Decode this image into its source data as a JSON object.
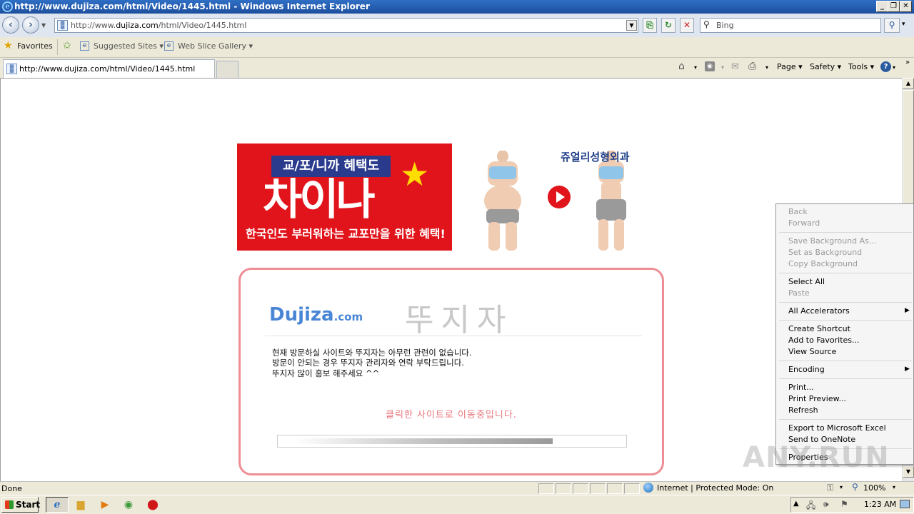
{
  "window": {
    "title": "http://www.dujiza.com/html/Video/1445.html - Windows Internet Explorer",
    "min_glyph": "_",
    "restore_glyph": "❐",
    "close_glyph": "✕"
  },
  "toolbar": {
    "address_prefix": "http://www.",
    "address_domain": "dujiza.com",
    "address_suffix": "/html/Video/1445.html",
    "search_placeholder": "Bing"
  },
  "favorites_bar": {
    "favorites_label": "Favorites",
    "suggested_sites_label": "Suggested Sites",
    "web_slice_gallery_label": "Web Slice Gallery"
  },
  "tabs": {
    "active_tab_label": "http://www.dujiza.com/html/Video/1445.html"
  },
  "command_bar": {
    "page_label": "Page",
    "safety_label": "Safety",
    "tools_label": "Tools"
  },
  "banner": {
    "top_label": "교/포/니까 혜택도",
    "big_label": "차이나",
    "bottom_label": "한국인도 부러워하는 교포만을 위한 혜택!",
    "clinic_name": "쥬얼리성형외과"
  },
  "notice": {
    "brand": "Dujiza",
    "brand_suffix": ".com",
    "brand_korean": "뚜지자",
    "line1": "현재 방문하실 사이트와 뚜지자는 아무런 관련이 없습니다.",
    "line2": "방문이 안되는 경우 뚜지자 관리자와 연락 부탁드립니다.",
    "line3": "뚜지자 많이 홍보 해주세요 ^^",
    "redirect_message": "클릭한 사이트로 이동중입니다.",
    "progress_fraction": 0.78
  },
  "context_menu": {
    "back": "Back",
    "forward": "Forward",
    "save_background": "Save Background As...",
    "set_as_background": "Set as Background",
    "copy_background": "Copy Background",
    "select_all": "Select All",
    "paste": "Paste",
    "all_accelerators": "All Accelerators",
    "create_shortcut": "Create Shortcut",
    "add_to_favorites": "Add to Favorites...",
    "view_source": "View Source",
    "encoding": "Encoding",
    "print": "Print...",
    "print_preview": "Print Preview...",
    "refresh": "Refresh",
    "export_excel": "Export to Microsoft Excel",
    "send_onenote": "Send to OneNote",
    "properties": "Properties"
  },
  "watermark": "ANY.RUN",
  "statusbar": {
    "status_text": "Done",
    "zone_text": "Internet | Protected Mode: On",
    "zoom_text": "100%"
  },
  "taskbar": {
    "start_label": "Start",
    "clock": "1:23 AM"
  }
}
